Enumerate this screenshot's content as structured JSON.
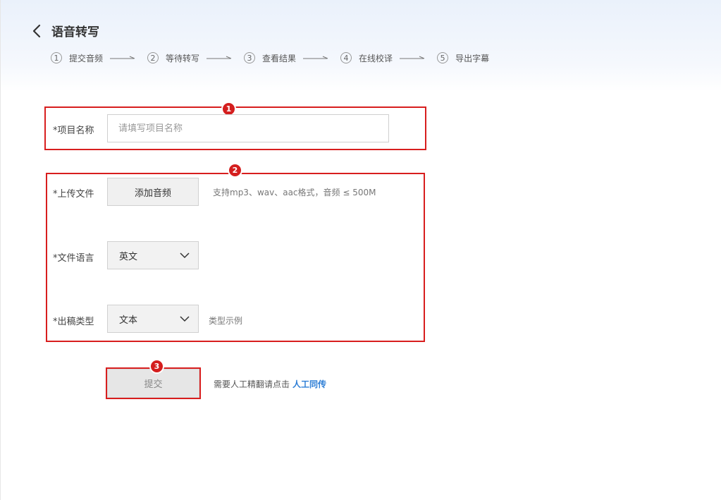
{
  "header": {
    "title": "语音转写",
    "back_icon": "chevron-left-icon"
  },
  "steps": [
    {
      "num": "1",
      "label": "提交音频"
    },
    {
      "num": "2",
      "label": "等待转写"
    },
    {
      "num": "3",
      "label": "查看结果"
    },
    {
      "num": "4",
      "label": "在线校译"
    },
    {
      "num": "5",
      "label": "导出字幕"
    }
  ],
  "annotations": {
    "a1": "1",
    "a2": "2",
    "a3": "3",
    "color": "#d81e1e"
  },
  "form": {
    "project_name": {
      "label": "*项目名称",
      "placeholder": "请填写项目名称",
      "value": ""
    },
    "upload": {
      "label": "*上传文件",
      "button": "添加音频",
      "hint": "支持mp3、wav、aac格式，音频 ≤ 500M"
    },
    "language": {
      "label": "*文件语言",
      "value": "英文"
    },
    "output_type": {
      "label": "*出稿类型",
      "value": "文本",
      "hint": "类型示例"
    }
  },
  "submit": {
    "label": "提交"
  },
  "footer": {
    "text": "需要人工精翻请点击",
    "link": "人工同传",
    "link_color": "#2f7fd6"
  }
}
